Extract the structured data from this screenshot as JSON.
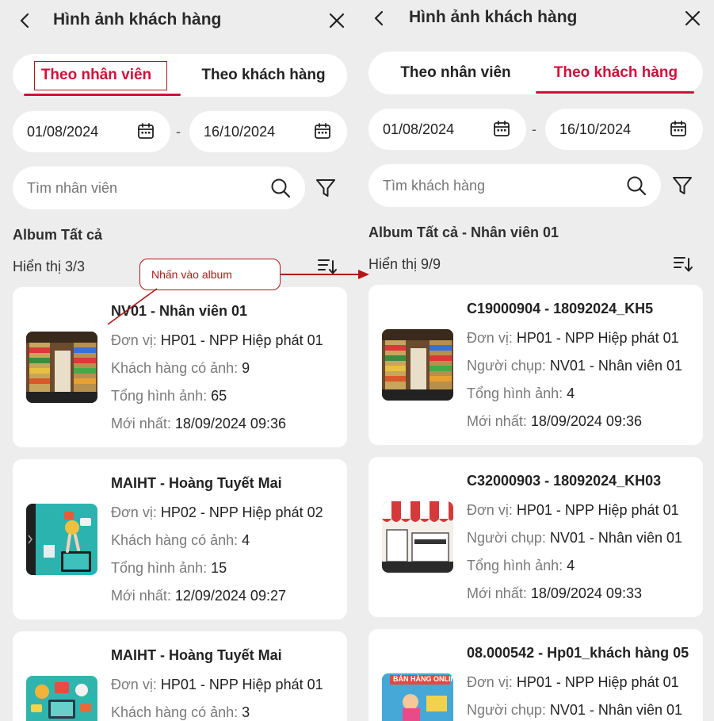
{
  "left": {
    "header": {
      "title": "Hình ảnh khách hàng"
    },
    "tabs": [
      {
        "label": "Theo nhân viên",
        "active": true
      },
      {
        "label": "Theo khách hàng",
        "active": false
      }
    ],
    "date_from": "01/08/2024",
    "date_to": "16/10/2024",
    "date_separator": "-",
    "search": {
      "placeholder": "Tìm nhân viên"
    },
    "album_title": "Album Tất cả",
    "count": "Hiển thị 3/3",
    "cards": [
      {
        "title": "NV01 - Nhân viên 01",
        "lines": [
          {
            "label": "Đơn vị: ",
            "value": "HP01 - NPP Hiệp phát 01"
          },
          {
            "label": "Khách hàng có ảnh: ",
            "value": "9"
          },
          {
            "label": "Tổng hình ảnh: ",
            "value": "65"
          },
          {
            "label": "Mới nhất: ",
            "value": "18/09/2024 09:36"
          }
        ]
      },
      {
        "title": "MAIHT - Hoàng Tuyết Mai",
        "lines": [
          {
            "label": "Đơn vị: ",
            "value": "HP02 - NPP Hiệp phát 02"
          },
          {
            "label": "Khách hàng có ảnh: ",
            "value": "4"
          },
          {
            "label": "Tổng hình ảnh: ",
            "value": "15"
          },
          {
            "label": "Mới nhất: ",
            "value": "12/09/2024 09:27"
          }
        ]
      },
      {
        "title": "MAIHT - Hoàng Tuyết Mai",
        "lines": [
          {
            "label": "Đơn vị: ",
            "value": "HP01 - NPP Hiệp phát 01"
          },
          {
            "label": "Khách hàng có ảnh: ",
            "value": "3"
          }
        ]
      }
    ]
  },
  "right": {
    "header": {
      "title": "Hình ảnh khách hàng"
    },
    "tabs": [
      {
        "label": "Theo nhân viên",
        "active": false
      },
      {
        "label": "Theo khách hàng",
        "active": true
      }
    ],
    "date_from": "01/08/2024",
    "date_to": "16/10/2024",
    "date_separator": "-",
    "search": {
      "placeholder": "Tìm khách hàng"
    },
    "album_title": "Album Tất cả - Nhân viên 01",
    "count": "Hiển thị 9/9",
    "cards": [
      {
        "title": "C19000904 - 18092024_KH5",
        "lines": [
          {
            "label": "Đơn vị: ",
            "value": "HP01 - NPP Hiệp phát 01"
          },
          {
            "label": "Người chụp: ",
            "value": "NV01 - Nhân viên 01"
          },
          {
            "label": "Tổng hình ảnh: ",
            "value": "4"
          },
          {
            "label": "Mới nhất: ",
            "value": "18/09/2024 09:36"
          }
        ]
      },
      {
        "title": "C32000903 - 18092024_KH03",
        "lines": [
          {
            "label": "Đơn vị: ",
            "value": "HP01 - NPP Hiệp phát 01"
          },
          {
            "label": "Người chụp: ",
            "value": "NV01 - Nhân viên 01"
          },
          {
            "label": "Tổng hình ảnh: ",
            "value": "4"
          },
          {
            "label": "Mới nhất: ",
            "value": "18/09/2024 09:33"
          }
        ]
      },
      {
        "title": "08.000542 - Hp01_khách hàng 05",
        "thumb_text": "BÁN HÀNG ONLINE",
        "lines": [
          {
            "label": "Đơn vị: ",
            "value": "HP01 - NPP Hiệp phát 01"
          },
          {
            "label": "Người chụp: ",
            "value": "NV01 - Nhân viên 01"
          }
        ]
      }
    ]
  },
  "annotation": {
    "callout": "Nhấn vào album"
  },
  "icons": {
    "back": "chevron-left-icon",
    "close": "close-icon",
    "calendar": "calendar-icon",
    "search": "search-icon",
    "filter": "filter-icon",
    "sort": "sort-icon"
  },
  "colors": {
    "accent": "#d0103a",
    "annotation": "#b01818",
    "background": "#ededed",
    "card": "#ffffff"
  }
}
